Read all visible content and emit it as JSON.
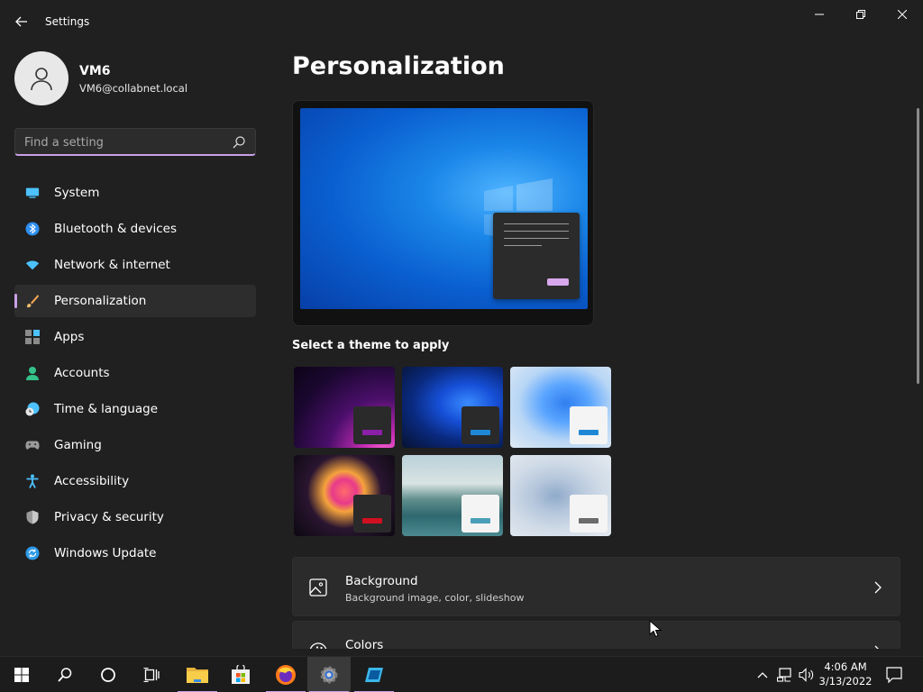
{
  "window": {
    "title": "Settings",
    "controls": [
      "minimize",
      "maximize",
      "close"
    ]
  },
  "profile": {
    "name": "VM6",
    "email": "VM6@collabnet.local"
  },
  "search": {
    "placeholder": "Find a setting"
  },
  "nav": {
    "items": [
      {
        "label": "System",
        "icon": "monitor-icon",
        "active": false
      },
      {
        "label": "Bluetooth & devices",
        "icon": "bluetooth-icon",
        "active": false
      },
      {
        "label": "Network & internet",
        "icon": "wifi-icon",
        "active": false
      },
      {
        "label": "Personalization",
        "icon": "brush-icon",
        "active": true
      },
      {
        "label": "Apps",
        "icon": "apps-icon",
        "active": false
      },
      {
        "label": "Accounts",
        "icon": "person-icon",
        "active": false
      },
      {
        "label": "Time & language",
        "icon": "clock-globe-icon",
        "active": false
      },
      {
        "label": "Gaming",
        "icon": "gamepad-icon",
        "active": false
      },
      {
        "label": "Accessibility",
        "icon": "accessibility-icon",
        "active": false
      },
      {
        "label": "Privacy & security",
        "icon": "shield-icon",
        "active": false
      },
      {
        "label": "Windows Update",
        "icon": "update-icon",
        "active": false
      }
    ]
  },
  "main": {
    "title": "Personalization",
    "theme_heading": "Select a theme to apply",
    "themes": [
      {
        "name": "glow",
        "accent": "#8a1fa8"
      },
      {
        "name": "windows-dark",
        "accent": "#1e88d6"
      },
      {
        "name": "windows-light",
        "accent": "#1e88d6"
      },
      {
        "name": "captured-motion",
        "accent": "#d01020"
      },
      {
        "name": "flow",
        "accent": "#4a9fb8"
      },
      {
        "name": "sunrise",
        "accent": "#6b6b6b"
      }
    ],
    "rows": [
      {
        "title": "Background",
        "subtitle": "Background image, color, slideshow",
        "icon": "image-icon"
      },
      {
        "title": "Colors",
        "subtitle": "",
        "icon": "palette-icon"
      }
    ]
  },
  "taskbar": {
    "apps": [
      "start-icon",
      "search-icon",
      "cortana-icon",
      "task-view-icon",
      "file-explorer-icon",
      "store-icon",
      "firefox-icon",
      "settings-icon",
      "remote-app-icon"
    ],
    "time": "4:06 AM",
    "date": "3/13/2022"
  },
  "colors": {
    "accent": "#c9a0e6",
    "background": "#202020",
    "card": "#2b2b2b"
  }
}
